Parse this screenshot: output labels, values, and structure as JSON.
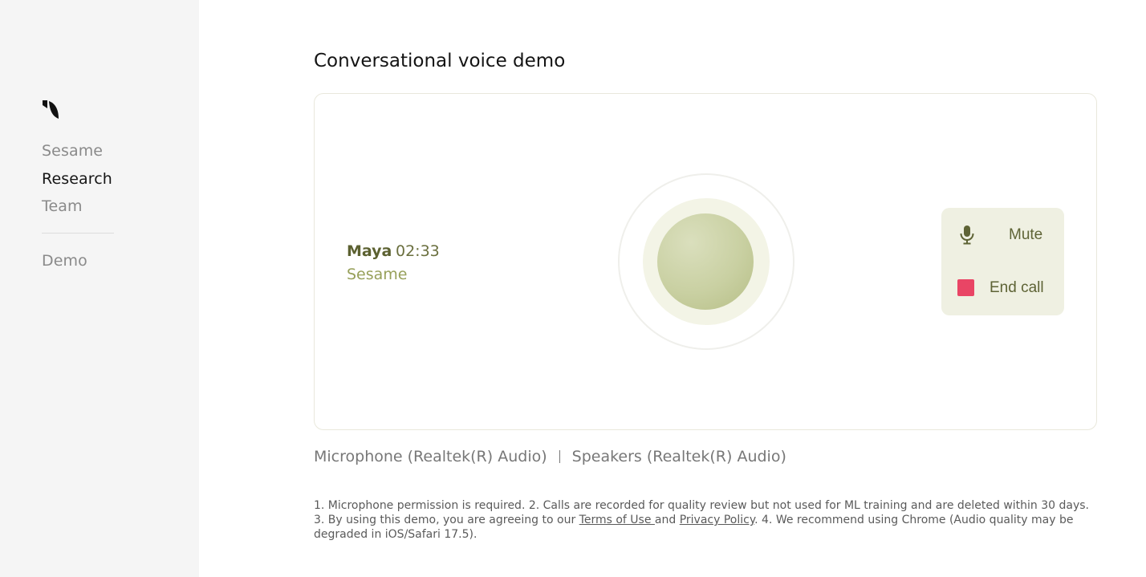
{
  "sidebar": {
    "logo_icon": "sesame-leaf-logo",
    "items": [
      {
        "label": "Sesame",
        "active": false
      },
      {
        "label": "Research",
        "active": true
      },
      {
        "label": "Team",
        "active": false
      },
      {
        "label": "Demo",
        "active": false
      }
    ]
  },
  "main": {
    "title": "Conversational voice demo",
    "call": {
      "name": "Maya",
      "timer": "02:33",
      "org": "Sesame"
    },
    "controls": {
      "mute_icon": "microphone-icon",
      "mute_label": "Mute",
      "end_icon": "stop-square-icon",
      "end_label": "End call"
    },
    "devices": {
      "microphone": "Microphone (Realtek(R) Audio)",
      "speakers": "Speakers (Realtek(R) Audio)"
    },
    "footnote": {
      "part1": "1. Microphone permission is required. 2. Calls are recorded for quality review but not used for ML training and are deleted within 30 days. 3. By using this demo, you are agreeing to our ",
      "terms_link": "Terms of Use ",
      "and": "and ",
      "privacy_link": "Privacy Policy",
      "part2": ". 4. We recommend using Chrome (Audio quality may be degraded in iOS/Safari 17.5)."
    }
  },
  "colors": {
    "sidebar_bg": "#f5f5f5",
    "accent_olive": "#5c6131",
    "orb": "#c9d0a2",
    "end_call_red": "#e94565",
    "controls_bg": "#eff0e2"
  }
}
